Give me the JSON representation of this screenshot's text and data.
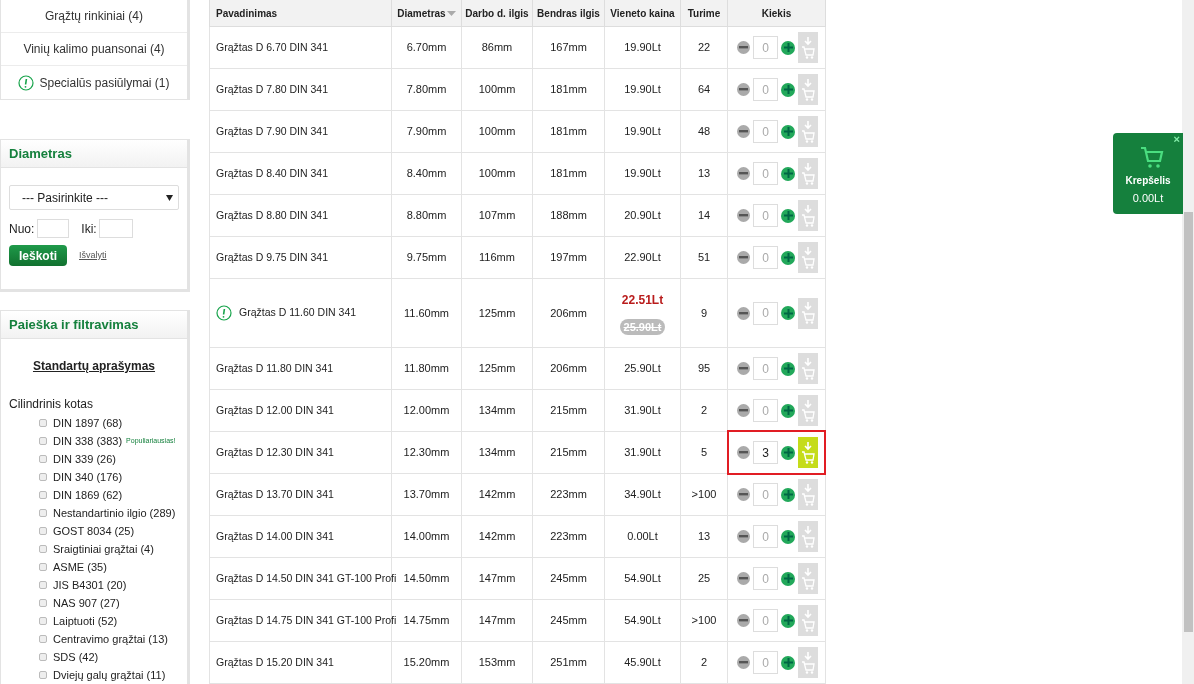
{
  "categories": [
    {
      "label": "Grąžtų rinkiniai (4)",
      "special": false
    },
    {
      "label": "Vinių kalimo puansonai (4)",
      "special": false
    },
    {
      "label": "Specialūs pasiūlymai (1)",
      "special": true
    }
  ],
  "diameter_filter": {
    "title": "Diametras",
    "select": "--- Pasirinkite ---",
    "from_label": "Nuo:",
    "to_label": "Iki:",
    "search_button": "Ieškoti",
    "clear_link": "Išvalyti"
  },
  "search_panel": {
    "title": "Paieška ir filtravimas",
    "standards_link": "Standartų aprašymas",
    "group": "Cilindrinis kotas",
    "options": [
      {
        "label": "DIN 1897 (68)",
        "checked": false
      },
      {
        "label": "DIN 338 (383)",
        "checked": false,
        "note": "Populiariausias!"
      },
      {
        "label": "DIN 339 (26)",
        "checked": false
      },
      {
        "label": "DIN 340 (176)",
        "checked": false
      },
      {
        "label": "DIN 1869 (62)",
        "checked": false
      },
      {
        "label": "Nestandartinio ilgio (289)",
        "checked": false
      },
      {
        "label": "GOST 8034 (25)",
        "checked": false
      },
      {
        "label": "Sraigtiniai grąžtai (4)",
        "checked": false
      },
      {
        "label": "ASME (35)",
        "checked": false
      },
      {
        "label": "JIS B4301 (20)",
        "checked": false
      },
      {
        "label": "NAS 907 (27)",
        "checked": false
      },
      {
        "label": "Laiptuoti (52)",
        "checked": false
      },
      {
        "label": "Centravimo grąžtai (13)",
        "checked": false
      },
      {
        "label": "SDS (42)",
        "checked": false
      },
      {
        "label": "Dviejų galų grąžtai (11)",
        "checked": false
      }
    ]
  },
  "table": {
    "columns": [
      {
        "label": "Pavadinimas",
        "sorted": false
      },
      {
        "label": "Diametras",
        "sorted": true
      },
      {
        "label": "Darbo d. ilgis",
        "sorted": false
      },
      {
        "label": "Bendras ilgis",
        "sorted": false
      },
      {
        "label": "Vieneto kaina",
        "sorted": false
      },
      {
        "label": "Turime",
        "sorted": false
      },
      {
        "label": "Kiekis",
        "sorted": false
      }
    ],
    "rows": [
      {
        "kind": "normal",
        "name": "Grąžtas D 6.70 DIN 341",
        "diameter": "6.70mm",
        "work_length": "86mm",
        "total_length": "167mm",
        "price": "19.90Lt",
        "stock": "22",
        "quantity": "0",
        "highlighted": false
      },
      {
        "kind": "normal",
        "name": "Grąžtas D 7.80 DIN 341",
        "diameter": "7.80mm",
        "work_length": "100mm",
        "total_length": "181mm",
        "price": "19.90Lt",
        "stock": "64",
        "quantity": "0",
        "highlighted": false
      },
      {
        "kind": "normal",
        "name": "Grąžtas D 7.90 DIN 341",
        "diameter": "7.90mm",
        "work_length": "100mm",
        "total_length": "181mm",
        "price": "19.90Lt",
        "stock": "48",
        "quantity": "0",
        "highlighted": false
      },
      {
        "kind": "normal",
        "name": "Grąžtas D 8.40 DIN 341",
        "diameter": "8.40mm",
        "work_length": "100mm",
        "total_length": "181mm",
        "price": "19.90Lt",
        "stock": "13",
        "quantity": "0",
        "highlighted": false
      },
      {
        "kind": "normal",
        "name": "Grąžtas D 8.80 DIN 341",
        "diameter": "8.80mm",
        "work_length": "107mm",
        "total_length": "188mm",
        "price": "20.90Lt",
        "stock": "14",
        "quantity": "0",
        "highlighted": false
      },
      {
        "kind": "normal",
        "name": "Grąžtas D 9.75 DIN 341",
        "diameter": "9.75mm",
        "work_length": "116mm",
        "total_length": "197mm",
        "price": "22.90Lt",
        "stock": "51",
        "quantity": "0",
        "highlighted": false
      },
      {
        "kind": "special",
        "name": "Grąžtas D 11.60 DIN 341",
        "diameter": "11.60mm",
        "work_length": "125mm",
        "total_length": "206mm",
        "price": "22.51Lt",
        "old_price": "25.90Lt",
        "stock": "9",
        "quantity": "0",
        "highlighted": false
      },
      {
        "kind": "normal",
        "name": "Grąžtas D 11.80 DIN 341",
        "diameter": "11.80mm",
        "work_length": "125mm",
        "total_length": "206mm",
        "price": "25.90Lt",
        "stock": "95",
        "quantity": "0",
        "highlighted": false
      },
      {
        "kind": "normal",
        "name": "Grąžtas D 12.00 DIN 341",
        "diameter": "12.00mm",
        "work_length": "134mm",
        "total_length": "215mm",
        "price": "31.90Lt",
        "stock": "2",
        "quantity": "0",
        "highlighted": false
      },
      {
        "kind": "normal",
        "name": "Grąžtas D 12.30 DIN 341",
        "diameter": "12.30mm",
        "work_length": "134mm",
        "total_length": "215mm",
        "price": "31.90Lt",
        "stock": "5",
        "quantity": "3",
        "highlighted": true
      },
      {
        "kind": "normal",
        "name": "Grąžtas D 13.70 DIN 341",
        "diameter": "13.70mm",
        "work_length": "142mm",
        "total_length": "223mm",
        "price": "34.90Lt",
        "stock": ">100",
        "quantity": "0",
        "highlighted": false
      },
      {
        "kind": "normal",
        "name": "Grąžtas D 14.00 DIN 341",
        "diameter": "14.00mm",
        "work_length": "142mm",
        "total_length": "223mm",
        "price": "0.00Lt",
        "stock": "13",
        "quantity": "0",
        "highlighted": false
      },
      {
        "kind": "normal",
        "name": "Grąžtas D 14.50 DIN 341 GT-100 Profi",
        "diameter": "14.50mm",
        "work_length": "147mm",
        "total_length": "245mm",
        "price": "54.90Lt",
        "stock": "25",
        "quantity": "0",
        "highlighted": false
      },
      {
        "kind": "normal",
        "name": "Grąžtas D 14.75 DIN 341 GT-100 Profi",
        "diameter": "14.75mm",
        "work_length": "147mm",
        "total_length": "245mm",
        "price": "54.90Lt",
        "stock": ">100",
        "quantity": "0",
        "highlighted": false
      },
      {
        "kind": "normal",
        "name": "Grąžtas D 15.20 DIN 341",
        "diameter": "15.20mm",
        "work_length": "153mm",
        "total_length": "251mm",
        "price": "45.90Lt",
        "stock": "2",
        "quantity": "0",
        "highlighted": false
      }
    ]
  },
  "cart": {
    "title": "Krepšelis",
    "total": "0.00Lt",
    "close": "×"
  }
}
